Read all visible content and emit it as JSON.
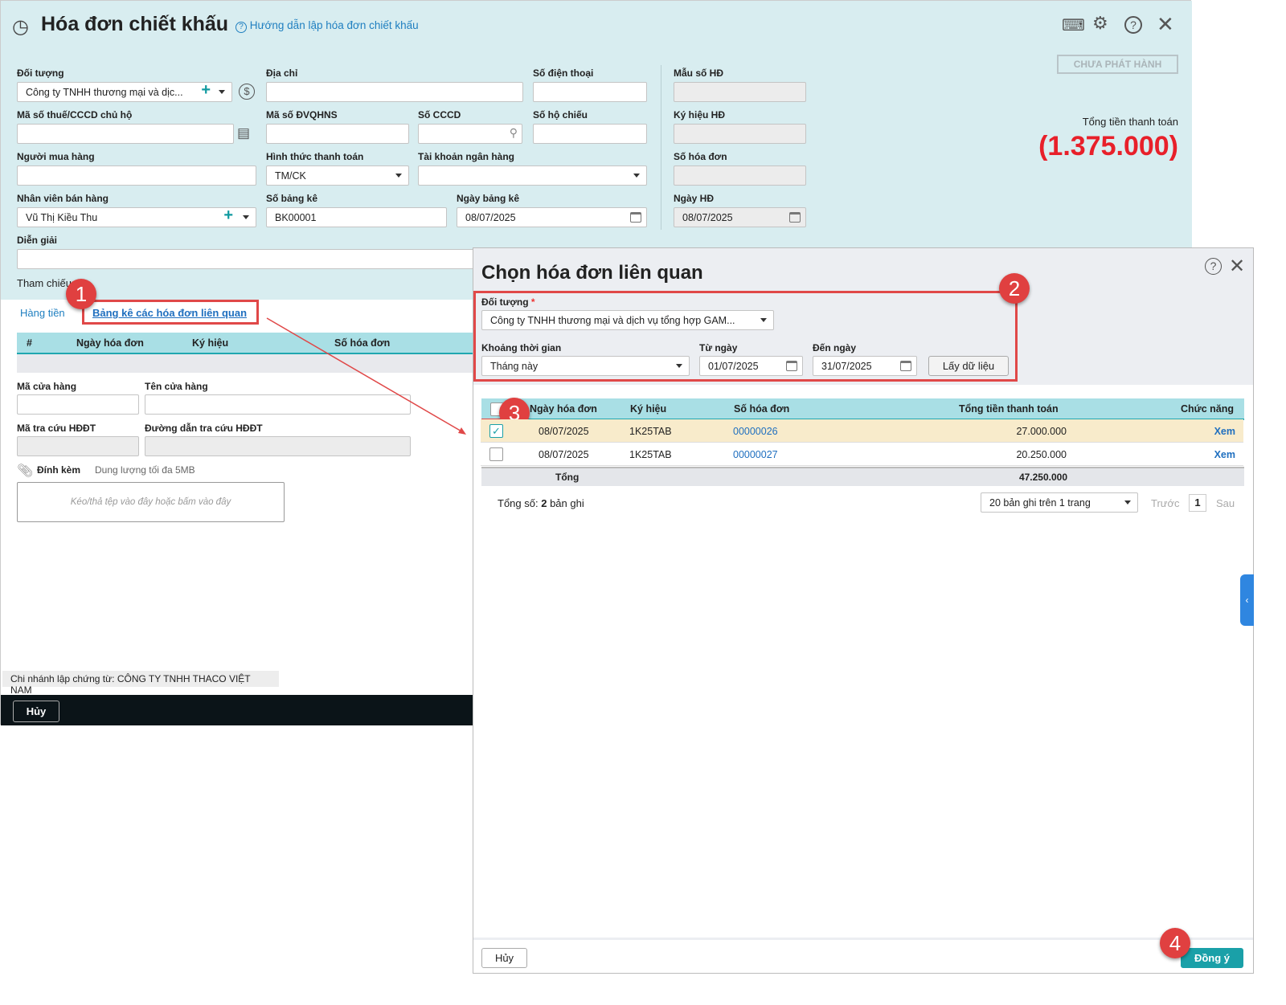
{
  "header": {
    "title": "Hóa đơn chiết khấu",
    "help_link": "Hướng dẫn lập hóa đơn chiết khấu",
    "status_button": "CHƯA PHÁT HÀNH",
    "total_label": "Tổng tiền thanh toán",
    "total_value": "(1.375.000)"
  },
  "form": {
    "doi_tuong": {
      "label": "Đối tượng",
      "value": "Công ty TNHH thương mại và dịc..."
    },
    "dia_chi": {
      "label": "Địa chỉ",
      "value": ""
    },
    "so_dien_thoai": {
      "label": "Số điện thoại",
      "value": ""
    },
    "mau_so": {
      "label": "Mẫu số HĐ",
      "value": ""
    },
    "ma_so_thue": {
      "label": "Mã số thuế/CCCD chủ hộ",
      "value": ""
    },
    "ma_dvqhns": {
      "label": "Mã số ĐVQHNS",
      "value": ""
    },
    "so_cccd": {
      "label": "Số CCCD",
      "value": ""
    },
    "so_ho_chieu": {
      "label": "Số hộ chiếu",
      "value": ""
    },
    "ky_hieu": {
      "label": "Ký hiệu HĐ",
      "value": ""
    },
    "nguoi_mua": {
      "label": "Người mua hàng",
      "value": ""
    },
    "hinh_thuc": {
      "label": "Hình thức thanh toán",
      "value": "TM/CK"
    },
    "tai_khoan": {
      "label": "Tài khoản ngân hàng",
      "value": ""
    },
    "so_hoa_don": {
      "label": "Số hóa đơn",
      "value": ""
    },
    "nhan_vien": {
      "label": "Nhân viên bán hàng",
      "value": "Vũ Thị Kiều Thu"
    },
    "so_bang_ke": {
      "label": "Số bảng kê",
      "value": "BK00001"
    },
    "ngay_bang_ke": {
      "label": "Ngày bảng kê",
      "value": "08/07/2025"
    },
    "ngay_hd": {
      "label": "Ngày HĐ",
      "value": "08/07/2025"
    },
    "dien_giai": {
      "label": "Diễn giải",
      "value": ""
    },
    "tham_chieu": "Tham chiếu ..."
  },
  "tabs": [
    "Hàng tiền",
    "Bảng kê các hóa đơn liên quan"
  ],
  "left_table": {
    "headers": [
      "#",
      "Ngày hóa đơn",
      "Ký hiệu",
      "Số hóa đơn"
    ]
  },
  "store": {
    "ma_cua_hang": "Mã cửa hàng",
    "ten_cua_hang": "Tên cửa hàng",
    "ma_tra_cuu": "Mã tra cứu HĐĐT",
    "duong_dan": "Đường dẫn tra cứu HĐĐT"
  },
  "attach": {
    "label": "Đính kèm",
    "limit": "Dung lượng tối đa 5MB",
    "drop": "Kéo/thả tệp vào đây hoặc bấm vào đây"
  },
  "footer": {
    "branch": "Chi nhánh lập chứng từ: CÔNG TY TNHH THACO VIỆT NAM",
    "cancel": "Hủy"
  },
  "dialog": {
    "title": "Chọn hóa đơn liên quan",
    "doi_tuong_label": "Đối tượng",
    "required": "*",
    "doi_tuong_value": "Công ty TNHH thương mại và dịch vụ tổng hợp GAM...",
    "khoang_label": "Khoảng thời gian",
    "khoang_value": "Tháng này",
    "tu_ngay_label": "Từ ngày",
    "tu_ngay": "01/07/2025",
    "den_ngay_label": "Đến ngày",
    "den_ngay": "31/07/2025",
    "fetch": "Lấy dữ liệu",
    "headers": [
      "Ngày hóa đơn",
      "Ký hiệu",
      "Số hóa đơn",
      "Tổng tiền thanh toán",
      "Chức năng"
    ],
    "rows": [
      {
        "checked": true,
        "date": "08/07/2025",
        "symbol": "1K25TAB",
        "number": "00000026",
        "total": "27.000.000",
        "action": "Xem"
      },
      {
        "checked": false,
        "date": "08/07/2025",
        "symbol": "1K25TAB",
        "number": "00000027",
        "total": "20.250.000",
        "action": "Xem"
      }
    ],
    "sum_label": "Tổng",
    "sum_value": "47.250.000",
    "count_prefix": "Tổng số:",
    "count": "2",
    "count_suffix": "bản ghi",
    "page_size": "20 bản ghi trên 1 trang",
    "prev": "Trước",
    "page": "1",
    "next": "Sau",
    "cancel": "Hủy",
    "ok": "Đồng ý"
  },
  "steps": [
    "1",
    "2",
    "3",
    "4"
  ]
}
